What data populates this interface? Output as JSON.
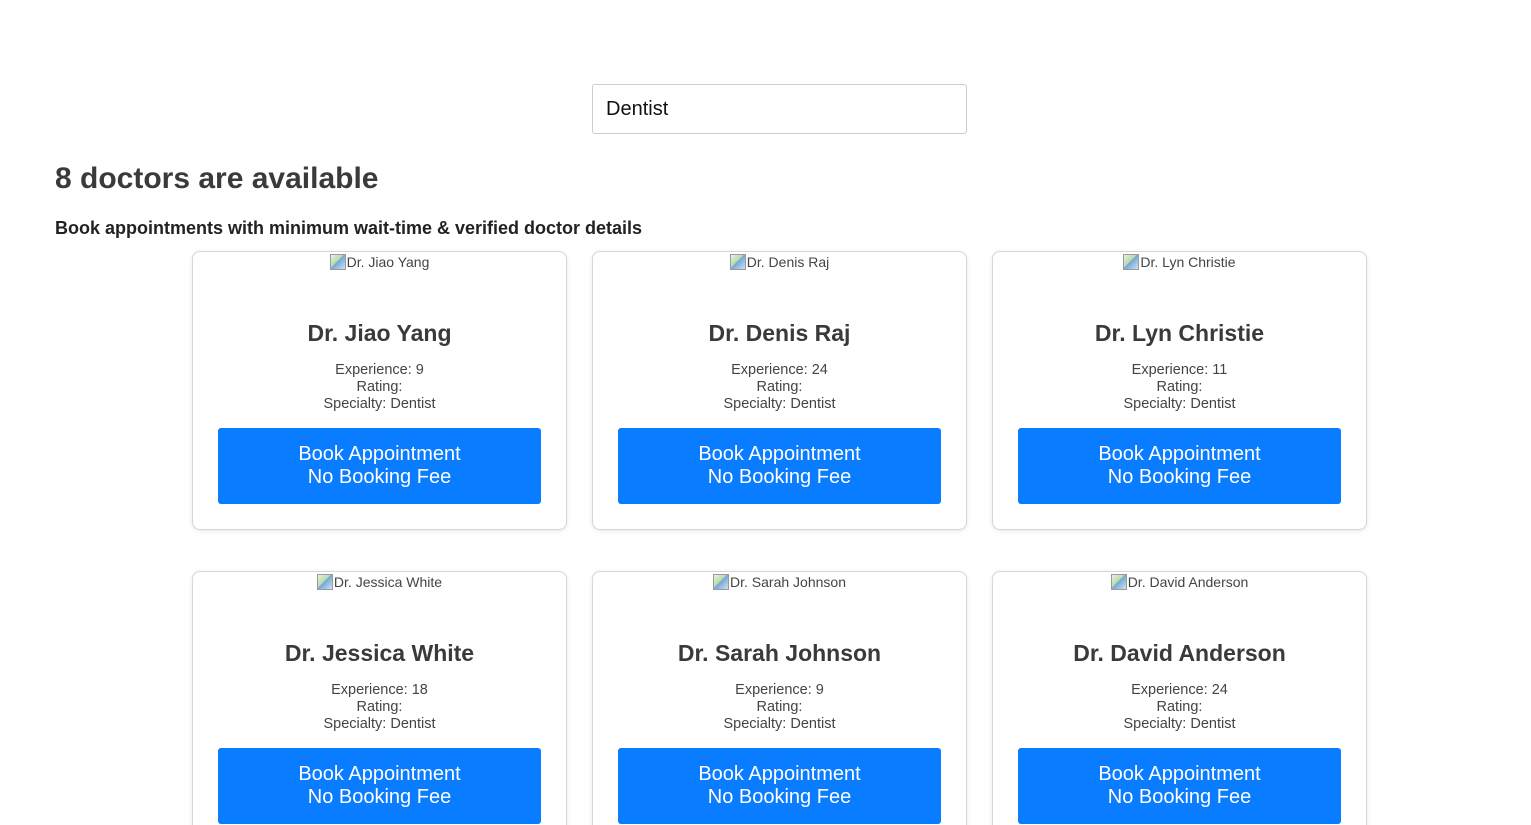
{
  "search": {
    "value": "Dentist"
  },
  "heading": "8 doctors are available",
  "subheading": "Book appointments with minimum wait-time & verified doctor details",
  "labels": {
    "experience": "Experience:",
    "rating": "Rating:",
    "specialty": "Specialty:",
    "book_line1": "Book Appointment",
    "book_line2": "No Booking Fee"
  },
  "colors": {
    "button": "#0a7cff",
    "heading": "#3a3a3a"
  },
  "doctors": [
    {
      "name": "Dr. Jiao Yang",
      "alt": "Dr. Jiao Yang",
      "experience": "9",
      "rating": "",
      "specialty": "Dentist"
    },
    {
      "name": "Dr. Denis Raj",
      "alt": "Dr. Denis Raj",
      "experience": "24",
      "rating": "",
      "specialty": "Dentist"
    },
    {
      "name": "Dr. Lyn Christie",
      "alt": "Dr. Lyn Christie",
      "experience": "11",
      "rating": "",
      "specialty": "Dentist"
    },
    {
      "name": "Dr. Jessica White",
      "alt": "Dr. Jessica White",
      "experience": "18",
      "rating": "",
      "specialty": "Dentist"
    },
    {
      "name": "Dr. Sarah Johnson",
      "alt": "Dr. Sarah Johnson",
      "experience": "9",
      "rating": "",
      "specialty": "Dentist"
    },
    {
      "name": "Dr. David Anderson",
      "alt": "Dr. David Anderson",
      "experience": "24",
      "rating": "",
      "specialty": "Dentist"
    }
  ]
}
